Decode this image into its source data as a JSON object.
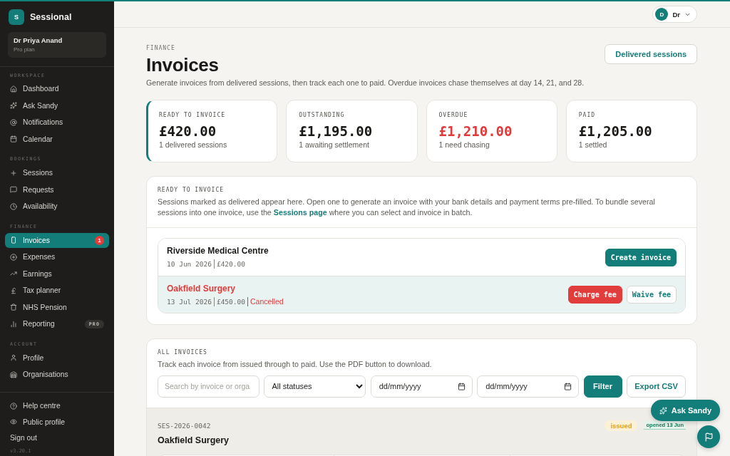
{
  "sidebar": {
    "brand": {
      "initial": "S",
      "name": "Sessional"
    },
    "user": {
      "name": "Dr Priya Anand",
      "plan": "Pro plan"
    },
    "sections": [
      {
        "title": "WORKSPACE",
        "items": [
          {
            "label": "Dashboard",
            "selected": false
          },
          {
            "label": "Ask Sandy",
            "selected": false
          },
          {
            "label": "Notifications",
            "selected": false
          },
          {
            "label": "Calendar",
            "selected": false
          }
        ]
      },
      {
        "title": "BOOKINGS",
        "items": [
          {
            "label": "Sessions",
            "selected": false
          },
          {
            "label": "Requests",
            "selected": false
          },
          {
            "label": "Availability",
            "selected": false
          }
        ]
      },
      {
        "title": "FINANCE",
        "items": [
          {
            "label": "Invoices",
            "selected": true,
            "badge": "1"
          },
          {
            "label": "Expenses",
            "selected": false
          },
          {
            "label": "Earnings",
            "selected": false
          },
          {
            "label": "Tax planner",
            "selected": false
          },
          {
            "label": "NHS Pension",
            "selected": false
          },
          {
            "label": "Reporting",
            "selected": false,
            "tag": "PRO"
          }
        ]
      },
      {
        "title": "ACCOUNT",
        "items": [
          {
            "label": "Profile",
            "selected": false
          },
          {
            "label": "Organisations",
            "selected": false
          }
        ]
      }
    ],
    "footer_links": [
      {
        "label": "Help centre",
        "kind": "icon"
      },
      {
        "label": "Public profile",
        "kind": "icon"
      },
      {
        "label": "Sign out",
        "kind": "plain"
      }
    ],
    "version": "v3.20.1"
  },
  "account_menu": {
    "initial": "D",
    "label": "Dr"
  },
  "header": {
    "eyebrow": "FINANCE",
    "title": "Invoices",
    "description": "Generate invoices from delivered sessions, then track each one to paid. Overdue invoices chase themselves at day 14, 21, and 28.",
    "action": "Delivered sessions"
  },
  "stats": [
    {
      "label": "READY TO INVOICE",
      "value": "£420.00",
      "note": "1 delivered sessions",
      "selected": true,
      "alert": false
    },
    {
      "label": "OUTSTANDING",
      "value": "£1,195.00",
      "note": "1 awaiting settlement",
      "selected": false,
      "alert": false
    },
    {
      "label": "OVERDUE",
      "value": "£1,210.00",
      "note": "1 need chasing",
      "selected": false,
      "alert": true
    },
    {
      "label": "PAID",
      "value": "£1,205.00",
      "note": "1 settled",
      "selected": false,
      "alert": false
    }
  ],
  "ready_to_invoice": {
    "label": "READY TO INVOICE",
    "text_before": "Sessions marked as delivered appear here. Open one to generate an invoice with your bank details and payment terms pre-filled. To bundle several sessions into one invoice, use the",
    "link": "Sessions page",
    "text_after": "where you can select and invoice in batch.",
    "items": [
      {
        "organisation": "Riverside Medical Centre",
        "date": "10 Jun 2026",
        "amount": "£420.00",
        "cancelled": false,
        "actions": [
          {
            "label": "Create invoice",
            "kind": "primary"
          }
        ]
      },
      {
        "organisation": "Oakfield Surgery",
        "date": "13 Jul 2026",
        "amount": "£450.00",
        "status": "Cancelled",
        "cancelled": true,
        "actions": [
          {
            "label": "Charge fee",
            "kind": "danger"
          },
          {
            "label": "Waive fee",
            "kind": "secondary"
          }
        ]
      }
    ]
  },
  "all_invoices": {
    "label": "ALL INVOICES",
    "text": "Track each invoice from issued through to paid. Use the PDF button to download.",
    "search_placeholder": "Search by invoice or orga",
    "status_filter": "All statuses",
    "date_from_placeholder": "dd/mm/yyyy",
    "date_to_placeholder": "dd/mm/yyyy",
    "buttons": [
      {
        "label": "Filter",
        "kind": "primary"
      },
      {
        "label": "Export CSV",
        "kind": "secondary"
      }
    ],
    "invoices": [
      {
        "number": "SES-2026-0042",
        "organisation": "Oakfield Surgery",
        "status": {
          "label": "issued",
          "kind": "pending"
        },
        "tracking": "opened 13 Jun"
      }
    ]
  },
  "assistant_button": "Ask Sandy"
}
